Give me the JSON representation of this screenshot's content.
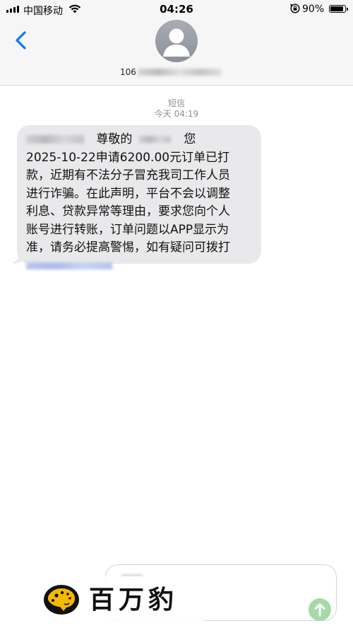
{
  "status_bar": {
    "carrier": "中国移动",
    "time": "04:26",
    "battery_percent": "90%",
    "battery_level": 0.9
  },
  "contact": {
    "number_prefix": "106"
  },
  "thread": {
    "channel": "短信",
    "timestamp": "今天 04:19"
  },
  "message": {
    "line1_greeting": "尊敬的",
    "line1_end": "您",
    "lines": [
      "2025-10-22申请6200.00元订单已打",
      "款，近期有不法分子冒充我司工作人员",
      "进行诈骗。在此声明，平台不会以调整",
      "利息、贷款异常等理由，要求您向个人",
      "账号进行转账，订单问题以APP显示为",
      "准，请务必提高警惕，如有疑问可拨打"
    ]
  },
  "watermark": {
    "text": "百万豹"
  },
  "colors": {
    "accent": "#007aff",
    "bubble": "#e9e9eb",
    "send_disabled": "#a6d9a8",
    "meta_text": "#8e8e93"
  }
}
